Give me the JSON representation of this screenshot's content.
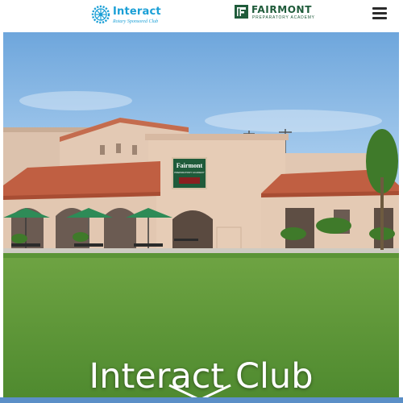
{
  "header": {
    "interact_logo": {
      "name": "Interact",
      "tagline": "Rotary Sponsored Club",
      "icon": "rotary-wheel-icon",
      "color": "#1a9fd6"
    },
    "fairmont_logo": {
      "name": "FAIRMONT",
      "subtitle": "PREPARATORY ACADEMY",
      "icon": "fairmont-mark-icon",
      "color": "#1f5b3a"
    },
    "menu": {
      "icon": "hamburger-menu-icon"
    }
  },
  "hero": {
    "title": "Interact Club",
    "image": "fairmont-campus-building-photo",
    "sign": {
      "name": "Fairmont",
      "line": "PREPARATORY ACADEMY"
    },
    "scroll_icon": "chevron-down-icon"
  },
  "colors": {
    "sky": "#8fbde6",
    "lawn": "#5f9a3c",
    "roof": "#b85a3c",
    "wall": "#e6ccb6",
    "bottom_band": "#5b8fc7"
  }
}
